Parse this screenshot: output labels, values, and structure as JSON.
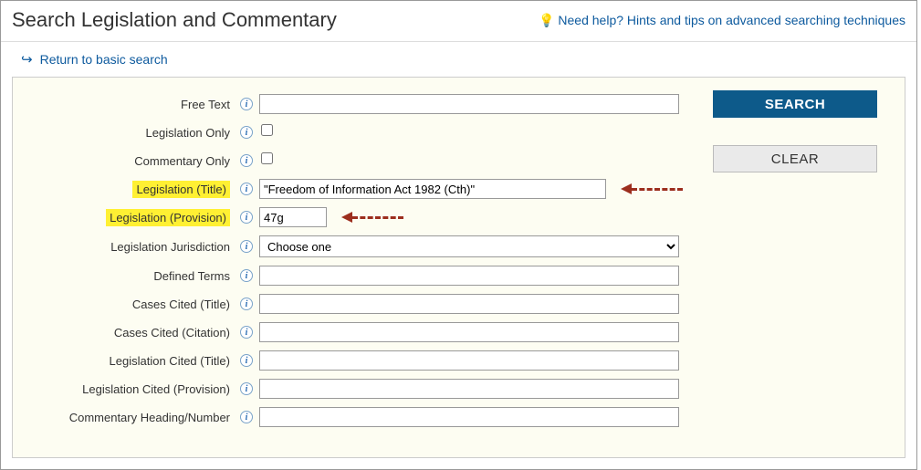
{
  "header": {
    "title": "Search Legislation and Commentary",
    "help_link": "Need help? Hints and tips on advanced searching techniques"
  },
  "return_link": "Return to basic search",
  "buttons": {
    "search": "SEARCH",
    "clear": "CLEAR"
  },
  "fields": {
    "free_text": {
      "label": "Free Text",
      "value": ""
    },
    "legislation_only": {
      "label": "Legislation Only",
      "checked": false
    },
    "commentary_only": {
      "label": "Commentary Only",
      "checked": false
    },
    "legislation_title": {
      "label": "Legislation (Title)",
      "value": "\"Freedom of Information Act 1982 (Cth)\""
    },
    "legislation_provision": {
      "label": "Legislation (Provision)",
      "value": "47g"
    },
    "legislation_jurisdiction": {
      "label": "Legislation Jurisdiction",
      "value": "Choose one"
    },
    "defined_terms": {
      "label": "Defined Terms",
      "value": ""
    },
    "cases_cited_title": {
      "label": "Cases Cited (Title)",
      "value": ""
    },
    "cases_cited_citation": {
      "label": "Cases Cited (Citation)",
      "value": ""
    },
    "legislation_cited_title": {
      "label": "Legislation Cited (Title)",
      "value": ""
    },
    "legislation_cited_provision": {
      "label": "Legislation Cited (Provision)",
      "value": ""
    },
    "commentary_heading": {
      "label": "Commentary Heading/Number",
      "value": ""
    }
  }
}
